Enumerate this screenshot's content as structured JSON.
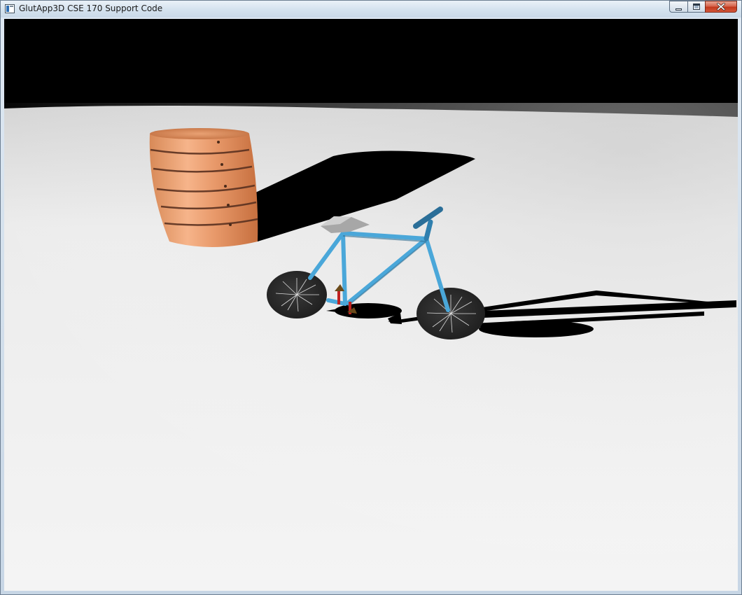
{
  "window": {
    "title": "GlutApp3D CSE 170 Support Code",
    "icon": "app-window-icon",
    "buttons": {
      "minimize": "minimize-icon",
      "maximize": "maximize-icon",
      "close": "close-icon"
    }
  },
  "scene": {
    "background_color": "#000000",
    "floor_color": "#f0f0f0",
    "shadow_color": "#000000",
    "objects": [
      {
        "name": "wooden-barrel",
        "color": "#e59a6f"
      },
      {
        "name": "bicycle",
        "frame_color": "#4aa7d9",
        "wheel_color": "#2b2b2b",
        "seat_color": "#a7a7a7",
        "pedal_color": "#c0211f"
      }
    ]
  }
}
